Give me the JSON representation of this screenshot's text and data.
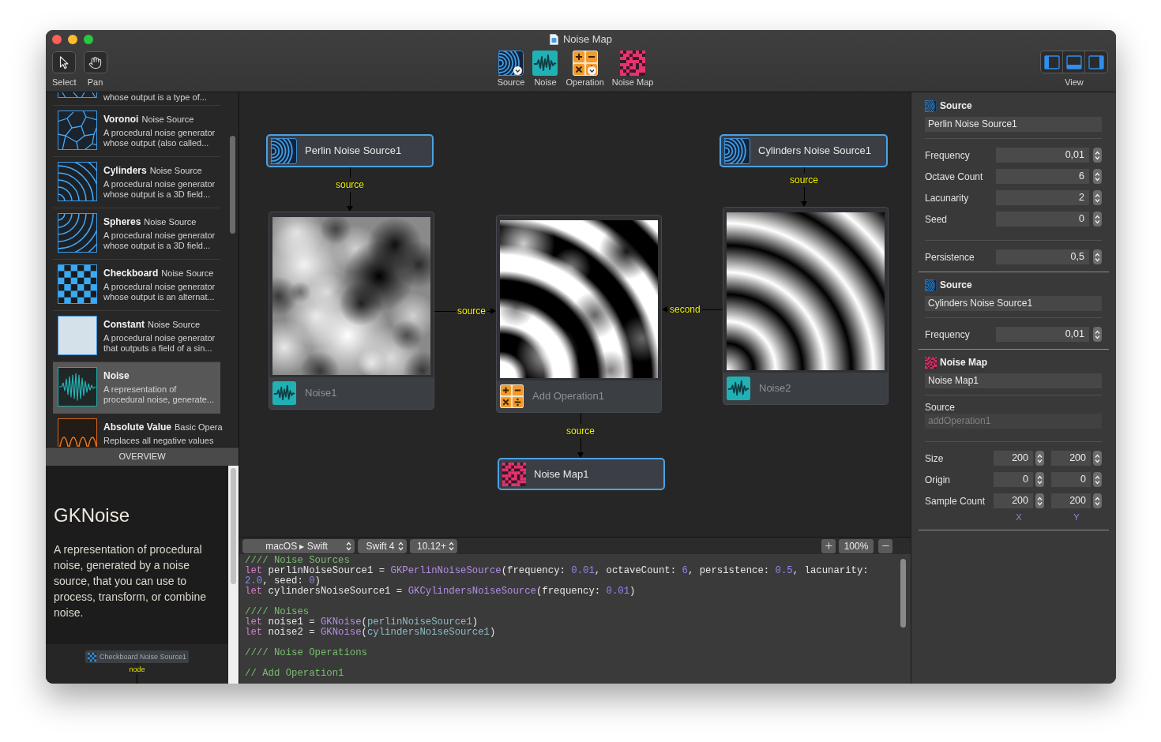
{
  "window": {
    "title": "Noise Map"
  },
  "toolbar": {
    "tools": [
      {
        "kind": "pointer",
        "label": "Select"
      },
      {
        "kind": "hand",
        "label": "Pan"
      }
    ],
    "node_buttons": [
      {
        "kind": "source",
        "label": "Source",
        "menu": true
      },
      {
        "kind": "noise",
        "label": "Noise",
        "menu": false
      },
      {
        "kind": "operation",
        "label": "Operation",
        "menu": true
      },
      {
        "kind": "map",
        "label": "Noise Map",
        "menu": false
      }
    ],
    "view": {
      "label": "View",
      "segments": [
        {
          "kind": "left",
          "on": true
        },
        {
          "kind": "bottom",
          "on": true
        },
        {
          "kind": "right",
          "on": true
        }
      ]
    }
  },
  "library": {
    "partial_item": {
      "description_end": "whose output is a type of..."
    },
    "items": [
      {
        "kind": "voronoi",
        "name": "Voronoi",
        "category": "Noise Source",
        "description": [
          "A procedural noise generator",
          "whose output (also called..."
        ],
        "selected": false
      },
      {
        "kind": "cylinders",
        "name": "Cylinders",
        "category": "Noise Source",
        "description": [
          "A procedural noise generator",
          "whose output is a 3D field..."
        ],
        "selected": false
      },
      {
        "kind": "spheres",
        "name": "Spheres",
        "category": "Noise Source",
        "description": [
          "A procedural noise generator",
          "whose output is a 3D field..."
        ],
        "selected": false
      },
      {
        "kind": "checkboard",
        "name": "Checkboard",
        "category": "Noise Source",
        "description": [
          "A procedural noise generator",
          "whose output is an alternat..."
        ],
        "selected": false
      },
      {
        "kind": "constant",
        "name": "Constant",
        "category": "Noise Source",
        "description": [
          "A procedural noise generator",
          "that outputs a field of a sin..."
        ],
        "selected": false
      },
      {
        "kind": "noise",
        "name": "Noise",
        "description": [
          "A representation of",
          "procedural noise, generate..."
        ],
        "selected": true
      },
      {
        "kind": "absolute",
        "name": "Absolute Value",
        "category": "Basic Opera",
        "description": [
          "Replaces all negative values"
        ],
        "selected": false
      }
    ]
  },
  "overview": {
    "header": "OVERVIEW",
    "title": "GKNoise",
    "body": "A representation of procedural noise, generated by a noise source, that you can use to process, transform, or combine noise.",
    "preview": {
      "node_label": "Checkboard Noise Source1",
      "edge_label": "node"
    }
  },
  "canvas": {
    "nodes": [
      {
        "kind": "source",
        "label": "Perlin Noise Source1"
      },
      {
        "kind": "source",
        "label": "Cylinders Noise Source1"
      },
      {
        "kind": "noise",
        "label": "Noise1"
      },
      {
        "kind": "operation",
        "label": "Add Operation1"
      },
      {
        "kind": "noise",
        "label": "Noise2"
      },
      {
        "kind": "map",
        "label": "Noise Map1"
      }
    ],
    "edges": [
      {
        "label": "source"
      },
      {
        "label": "source"
      },
      {
        "label": "source"
      },
      {
        "label": "second"
      },
      {
        "label": "source"
      }
    ]
  },
  "code_toolbar": {
    "popups": [
      {
        "label": "macOS ▸ Swift"
      },
      {
        "label": "Swift 4"
      },
      {
        "label": "10.12+"
      }
    ],
    "zoom": "100%"
  },
  "code": {
    "blocks": [
      [
        [
          {
            "kind": "comment",
            "text": "//// Noise Sources"
          }
        ],
        [
          {
            "kind": "keyword",
            "text": "let"
          },
          {
            "kind": "plain",
            "text": " perlinNoiseSource1 = "
          },
          {
            "kind": "type",
            "text": "GKPerlinNoiseSource"
          },
          {
            "kind": "plain",
            "text": "(frequency: "
          },
          {
            "kind": "number",
            "text": "0.01"
          },
          {
            "kind": "plain",
            "text": ", octaveCount: "
          },
          {
            "kind": "number",
            "text": "6"
          },
          {
            "kind": "plain",
            "text": ", persistence: "
          },
          {
            "kind": "number",
            "text": "0.5"
          },
          {
            "kind": "plain",
            "text": ", lacunarity:"
          }
        ],
        [
          {
            "kind": "number",
            "text": "2.0"
          },
          {
            "kind": "plain",
            "text": ", seed: "
          },
          {
            "kind": "number",
            "text": "0"
          },
          {
            "kind": "plain",
            "text": ")"
          }
        ],
        [
          {
            "kind": "keyword",
            "text": "let"
          },
          {
            "kind": "plain",
            "text": " cylindersNoiseSource1 = "
          },
          {
            "kind": "type",
            "text": "GKCylindersNoiseSource"
          },
          {
            "kind": "plain",
            "text": "(frequency: "
          },
          {
            "kind": "number",
            "text": "0.01"
          },
          {
            "kind": "plain",
            "text": ")"
          }
        ]
      ],
      [
        [
          {
            "kind": "comment",
            "text": "//// Noises"
          }
        ],
        [
          {
            "kind": "keyword",
            "text": "let"
          },
          {
            "kind": "plain",
            "text": " noise1 = "
          },
          {
            "kind": "type",
            "text": "GKNoise"
          },
          {
            "kind": "plain",
            "text": "("
          },
          {
            "kind": "ref",
            "text": "perlinNoiseSource1"
          },
          {
            "kind": "plain",
            "text": ")"
          }
        ],
        [
          {
            "kind": "keyword",
            "text": "let"
          },
          {
            "kind": "plain",
            "text": " noise2 = "
          },
          {
            "kind": "type",
            "text": "GKNoise"
          },
          {
            "kind": "plain",
            "text": "("
          },
          {
            "kind": "ref",
            "text": "cylindersNoiseSource1"
          },
          {
            "kind": "plain",
            "text": ")"
          }
        ]
      ],
      [
        [
          {
            "kind": "comment",
            "text": "//// Noise Operations"
          }
        ]
      ],
      [
        [
          {
            "kind": "comment",
            "text": "// Add Operation1"
          }
        ]
      ]
    ]
  },
  "inspector": {
    "sections": [
      {
        "kind": "source",
        "title": "Source",
        "name": "Perlin Noise Source1",
        "groups": [
          [
            {
              "kind": "number",
              "label": "Frequency",
              "value": "0,01"
            },
            {
              "kind": "number",
              "label": "Octave Count",
              "value": "6"
            },
            {
              "kind": "number",
              "label": "Lacunarity",
              "value": "2"
            },
            {
              "kind": "number",
              "label": "Seed",
              "value": "0"
            }
          ],
          [
            {
              "kind": "number",
              "label": "Persistence",
              "value": "0,5"
            }
          ]
        ]
      },
      {
        "kind": "source",
        "title": "Source",
        "name": "Cylinders Noise Source1",
        "groups": [
          [
            {
              "kind": "number",
              "label": "Frequency",
              "value": "0,01"
            }
          ]
        ]
      },
      {
        "kind": "map",
        "title": "Noise Map",
        "name": "Noise Map1",
        "groups": [
          [
            {
              "kind": "readonly",
              "label": "Source",
              "value": "addOperation1"
            }
          ],
          [
            {
              "kind": "pair",
              "label": "Size",
              "values": [
                "200",
                "200"
              ]
            },
            {
              "kind": "pair",
              "label": "Origin",
              "values": [
                "0",
                "0"
              ]
            },
            {
              "kind": "pair",
              "label": "Sample Count",
              "values": [
                "200",
                "200"
              ]
            }
          ]
        ],
        "axis_labels": [
          "X",
          "Y"
        ]
      }
    ]
  }
}
